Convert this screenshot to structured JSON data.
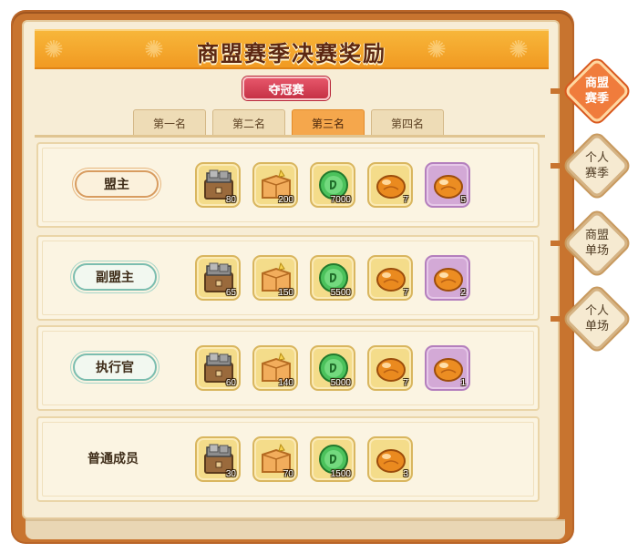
{
  "header": {
    "title": "商盟赛季决赛奖励",
    "badge": "夺冠赛"
  },
  "tabs": [
    {
      "label": "第一名",
      "active": false
    },
    {
      "label": "第二名",
      "active": false
    },
    {
      "label": "第三名",
      "active": true
    },
    {
      "label": "第四名",
      "active": false
    }
  ],
  "rows": [
    {
      "role": "盟主",
      "style": "gold",
      "items": [
        {
          "icon": "wooden-crate-icon",
          "count": "80"
        },
        {
          "icon": "gift-box-icon",
          "count": "200"
        },
        {
          "icon": "jade-coin-icon",
          "count": "7000"
        },
        {
          "icon": "amber-stone-icon",
          "count": "7"
        },
        {
          "icon": "amber-stone-rare-icon",
          "count": "5",
          "rare": true
        }
      ]
    },
    {
      "role": "副盟主",
      "style": "teal",
      "items": [
        {
          "icon": "wooden-crate-icon",
          "count": "65"
        },
        {
          "icon": "gift-box-icon",
          "count": "150"
        },
        {
          "icon": "jade-coin-icon",
          "count": "5500"
        },
        {
          "icon": "amber-stone-icon",
          "count": "7"
        },
        {
          "icon": "amber-stone-rare-icon",
          "count": "2",
          "rare": true
        }
      ]
    },
    {
      "role": "执行官",
      "style": "teal",
      "items": [
        {
          "icon": "wooden-crate-icon",
          "count": "60"
        },
        {
          "icon": "gift-box-icon",
          "count": "140"
        },
        {
          "icon": "jade-coin-icon",
          "count": "5000"
        },
        {
          "icon": "amber-stone-icon",
          "count": "7"
        },
        {
          "icon": "amber-stone-rare-icon",
          "count": "1",
          "rare": true
        }
      ]
    },
    {
      "role": "普通成员",
      "style": "plain",
      "items": [
        {
          "icon": "wooden-crate-icon",
          "count": "30"
        },
        {
          "icon": "gift-box-icon",
          "count": "70"
        },
        {
          "icon": "jade-coin-icon",
          "count": "1500"
        },
        {
          "icon": "amber-stone-icon",
          "count": "3"
        }
      ]
    }
  ],
  "side_tabs": [
    {
      "line1": "商盟",
      "line2": "赛季",
      "active": true
    },
    {
      "line1": "个人",
      "line2": "赛季",
      "active": false
    },
    {
      "line1": "商盟",
      "line2": "单场",
      "active": false
    },
    {
      "line1": "个人",
      "line2": "单场",
      "active": false
    }
  ],
  "colors": {
    "board": "#c8742f",
    "banner": "#f19a22",
    "active_tab": "#f5a74c",
    "side_active": "#f07c3c"
  }
}
